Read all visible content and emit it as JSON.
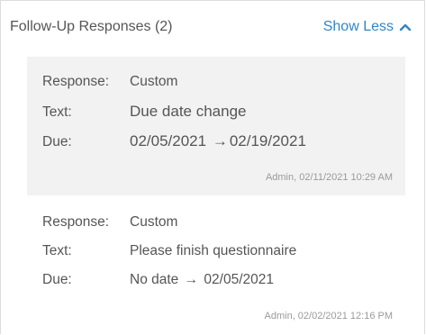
{
  "header": {
    "title": "Follow-Up Responses (2)",
    "toggle_label": "Show Less",
    "toggle_icon": "chevron-up-icon",
    "accent_color": "#2f86c6"
  },
  "responses": [
    {
      "response_label": "Response:",
      "response_value": "Custom",
      "text_label": "Text:",
      "text_value": "Due date change",
      "due_label": "Due:",
      "due_from": "02/05/2021",
      "due_arrow": "→",
      "due_to": "02/19/2021",
      "meta": "Admin, 02/11/2021 10:29 AM"
    },
    {
      "response_label": "Response:",
      "response_value": "Custom",
      "text_label": "Text:",
      "text_value": "Please finish questionnaire",
      "due_label": "Due:",
      "due_from": "No date",
      "due_arrow": "→",
      "due_to": "02/05/2021",
      "meta": "Admin, 02/02/2021 12:16 PM"
    }
  ]
}
